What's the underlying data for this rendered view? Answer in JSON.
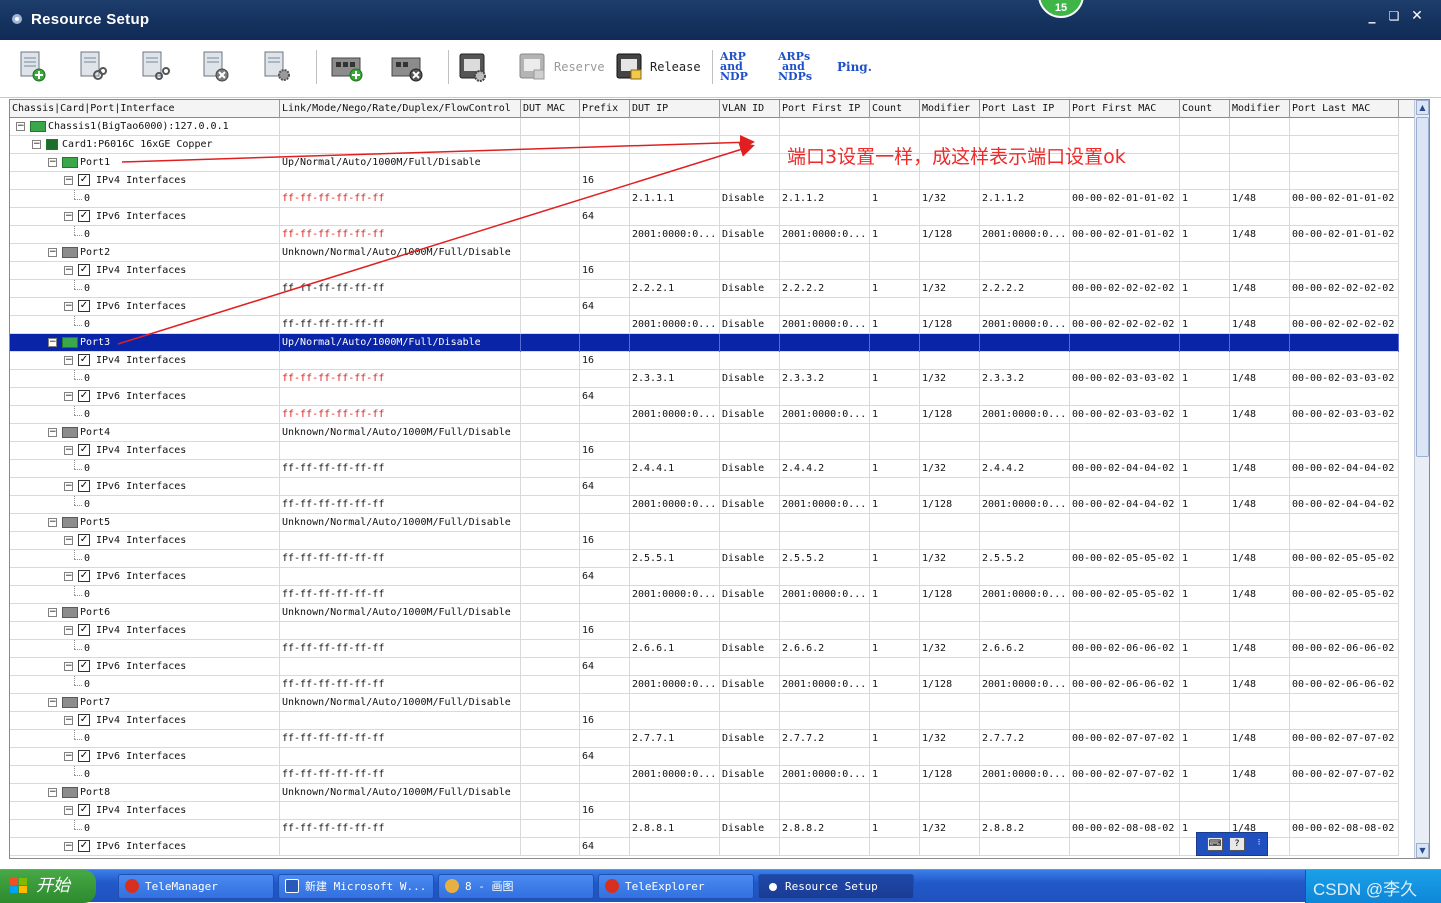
{
  "window": {
    "title": "Resource Setup",
    "badge": "15",
    "controls": [
      "_",
      "❏",
      "✕"
    ]
  },
  "toolbar": {
    "reserve_label": "Reserve",
    "release_label": "Release",
    "arp_ndp": [
      "ARP",
      "and",
      "NDP"
    ],
    "arps_ndps": [
      "ARPs",
      "and",
      "NDPs"
    ],
    "ping_label": "Ping."
  },
  "columns": [
    "Chassis|Card|Port|Interface",
    "Link/Mode/Nego/Rate/Duplex/FlowControl",
    "DUT MAC",
    "Prefix",
    "DUT IP",
    "VLAN ID",
    "Port First IP",
    "Count",
    "Modifier",
    "Port Last IP",
    "Port First MAC",
    "Count",
    "Modifier",
    "Port Last MAC"
  ],
  "tree_rows": [
    {
      "kind": "chassis",
      "label": "Chassis1(BigTao6000):127.0.0.1"
    },
    {
      "kind": "card",
      "label": "Card1:P6016C 16xGE Copper"
    },
    {
      "kind": "port",
      "label": "Port1",
      "status": "Up/Normal/Auto/1000M/Full/Disable",
      "up": true
    },
    {
      "kind": "iface",
      "label": "IPv4 Interfaces",
      "prefix": "16"
    },
    {
      "kind": "addr",
      "label": "0",
      "mac": "ff-ff-ff-ff-ff-ff",
      "mac_red": true,
      "dut_ip": "2.1.1.1",
      "vlan": "Disable",
      "first_ip": "2.1.1.2",
      "count": "1",
      "modifier": "1/32",
      "last_ip": "2.1.1.2",
      "first_mac": "00-00-02-01-01-02",
      "count2": "1",
      "modifier2": "1/48",
      "last_mac": "00-00-02-01-01-02"
    },
    {
      "kind": "iface",
      "label": "IPv6 Interfaces",
      "prefix": "64"
    },
    {
      "kind": "addr",
      "label": "0",
      "mac": "ff-ff-ff-ff-ff-ff",
      "mac_red": true,
      "dut_ip": "2001:0000:0...",
      "vlan": "Disable",
      "first_ip": "2001:0000:0...",
      "count": "1",
      "modifier": "1/128",
      "last_ip": "2001:0000:0...",
      "first_mac": "00-00-02-01-01-02",
      "count2": "1",
      "modifier2": "1/48",
      "last_mac": "00-00-02-01-01-02"
    },
    {
      "kind": "port",
      "label": "Port2",
      "status": "Unknown/Normal/Auto/1000M/Full/Disable",
      "up": false
    },
    {
      "kind": "iface",
      "label": "IPv4 Interfaces",
      "prefix": "16"
    },
    {
      "kind": "addr",
      "label": "0",
      "mac": "ff-ff-ff-ff-ff-ff",
      "mac_red": false,
      "dut_ip": "2.2.2.1",
      "vlan": "Disable",
      "first_ip": "2.2.2.2",
      "count": "1",
      "modifier": "1/32",
      "last_ip": "2.2.2.2",
      "first_mac": "00-00-02-02-02-02",
      "count2": "1",
      "modifier2": "1/48",
      "last_mac": "00-00-02-02-02-02"
    },
    {
      "kind": "iface",
      "label": "IPv6 Interfaces",
      "prefix": "64"
    },
    {
      "kind": "addr",
      "label": "0",
      "mac": "ff-ff-ff-ff-ff-ff",
      "mac_red": false,
      "dut_ip": "2001:0000:0...",
      "vlan": "Disable",
      "first_ip": "2001:0000:0...",
      "count": "1",
      "modifier": "1/128",
      "last_ip": "2001:0000:0...",
      "first_mac": "00-00-02-02-02-02",
      "count2": "1",
      "modifier2": "1/48",
      "last_mac": "00-00-02-02-02-02"
    },
    {
      "kind": "port",
      "label": "Port3",
      "status": "Up/Normal/Auto/1000M/Full/Disable",
      "up": true,
      "selected": true
    },
    {
      "kind": "iface",
      "label": "IPv4 Interfaces",
      "prefix": "16"
    },
    {
      "kind": "addr",
      "label": "0",
      "mac": "ff-ff-ff-ff-ff-ff",
      "mac_red": true,
      "dut_ip": "2.3.3.1",
      "vlan": "Disable",
      "first_ip": "2.3.3.2",
      "count": "1",
      "modifier": "1/32",
      "last_ip": "2.3.3.2",
      "first_mac": "00-00-02-03-03-02",
      "count2": "1",
      "modifier2": "1/48",
      "last_mac": "00-00-02-03-03-02"
    },
    {
      "kind": "iface",
      "label": "IPv6 Interfaces",
      "prefix": "64"
    },
    {
      "kind": "addr",
      "label": "0",
      "mac": "ff-ff-ff-ff-ff-ff",
      "mac_red": true,
      "dut_ip": "2001:0000:0...",
      "vlan": "Disable",
      "first_ip": "2001:0000:0...",
      "count": "1",
      "modifier": "1/128",
      "last_ip": "2001:0000:0...",
      "first_mac": "00-00-02-03-03-02",
      "count2": "1",
      "modifier2": "1/48",
      "last_mac": "00-00-02-03-03-02"
    },
    {
      "kind": "port",
      "label": "Port4",
      "status": "Unknown/Normal/Auto/1000M/Full/Disable",
      "up": false
    },
    {
      "kind": "iface",
      "label": "IPv4 Interfaces",
      "prefix": "16"
    },
    {
      "kind": "addr",
      "label": "0",
      "mac": "ff-ff-ff-ff-ff-ff",
      "mac_red": false,
      "dut_ip": "2.4.4.1",
      "vlan": "Disable",
      "first_ip": "2.4.4.2",
      "count": "1",
      "modifier": "1/32",
      "last_ip": "2.4.4.2",
      "first_mac": "00-00-02-04-04-02",
      "count2": "1",
      "modifier2": "1/48",
      "last_mac": "00-00-02-04-04-02"
    },
    {
      "kind": "iface",
      "label": "IPv6 Interfaces",
      "prefix": "64"
    },
    {
      "kind": "addr",
      "label": "0",
      "mac": "ff-ff-ff-ff-ff-ff",
      "mac_red": false,
      "dut_ip": "2001:0000:0...",
      "vlan": "Disable",
      "first_ip": "2001:0000:0...",
      "count": "1",
      "modifier": "1/128",
      "last_ip": "2001:0000:0...",
      "first_mac": "00-00-02-04-04-02",
      "count2": "1",
      "modifier2": "1/48",
      "last_mac": "00-00-02-04-04-02"
    },
    {
      "kind": "port",
      "label": "Port5",
      "status": "Unknown/Normal/Auto/1000M/Full/Disable",
      "up": false
    },
    {
      "kind": "iface",
      "label": "IPv4 Interfaces",
      "prefix": "16"
    },
    {
      "kind": "addr",
      "label": "0",
      "mac": "ff-ff-ff-ff-ff-ff",
      "mac_red": false,
      "dut_ip": "2.5.5.1",
      "vlan": "Disable",
      "first_ip": "2.5.5.2",
      "count": "1",
      "modifier": "1/32",
      "last_ip": "2.5.5.2",
      "first_mac": "00-00-02-05-05-02",
      "count2": "1",
      "modifier2": "1/48",
      "last_mac": "00-00-02-05-05-02"
    },
    {
      "kind": "iface",
      "label": "IPv6 Interfaces",
      "prefix": "64"
    },
    {
      "kind": "addr",
      "label": "0",
      "mac": "ff-ff-ff-ff-ff-ff",
      "mac_red": false,
      "dut_ip": "2001:0000:0...",
      "vlan": "Disable",
      "first_ip": "2001:0000:0...",
      "count": "1",
      "modifier": "1/128",
      "last_ip": "2001:0000:0...",
      "first_mac": "00-00-02-05-05-02",
      "count2": "1",
      "modifier2": "1/48",
      "last_mac": "00-00-02-05-05-02"
    },
    {
      "kind": "port",
      "label": "Port6",
      "status": "Unknown/Normal/Auto/1000M/Full/Disable",
      "up": false
    },
    {
      "kind": "iface",
      "label": "IPv4 Interfaces",
      "prefix": "16"
    },
    {
      "kind": "addr",
      "label": "0",
      "mac": "ff-ff-ff-ff-ff-ff",
      "mac_red": false,
      "dut_ip": "2.6.6.1",
      "vlan": "Disable",
      "first_ip": "2.6.6.2",
      "count": "1",
      "modifier": "1/32",
      "last_ip": "2.6.6.2",
      "first_mac": "00-00-02-06-06-02",
      "count2": "1",
      "modifier2": "1/48",
      "last_mac": "00-00-02-06-06-02"
    },
    {
      "kind": "iface",
      "label": "IPv6 Interfaces",
      "prefix": "64"
    },
    {
      "kind": "addr",
      "label": "0",
      "mac": "ff-ff-ff-ff-ff-ff",
      "mac_red": false,
      "dut_ip": "2001:0000:0...",
      "vlan": "Disable",
      "first_ip": "2001:0000:0...",
      "count": "1",
      "modifier": "1/128",
      "last_ip": "2001:0000:0...",
      "first_mac": "00-00-02-06-06-02",
      "count2": "1",
      "modifier2": "1/48",
      "last_mac": "00-00-02-06-06-02"
    },
    {
      "kind": "port",
      "label": "Port7",
      "status": "Unknown/Normal/Auto/1000M/Full/Disable",
      "up": false
    },
    {
      "kind": "iface",
      "label": "IPv4 Interfaces",
      "prefix": "16"
    },
    {
      "kind": "addr",
      "label": "0",
      "mac": "ff-ff-ff-ff-ff-ff",
      "mac_red": false,
      "dut_ip": "2.7.7.1",
      "vlan": "Disable",
      "first_ip": "2.7.7.2",
      "count": "1",
      "modifier": "1/32",
      "last_ip": "2.7.7.2",
      "first_mac": "00-00-02-07-07-02",
      "count2": "1",
      "modifier2": "1/48",
      "last_mac": "00-00-02-07-07-02"
    },
    {
      "kind": "iface",
      "label": "IPv6 Interfaces",
      "prefix": "64"
    },
    {
      "kind": "addr",
      "label": "0",
      "mac": "ff-ff-ff-ff-ff-ff",
      "mac_red": false,
      "dut_ip": "2001:0000:0...",
      "vlan": "Disable",
      "first_ip": "2001:0000:0...",
      "count": "1",
      "modifier": "1/128",
      "last_ip": "2001:0000:0...",
      "first_mac": "00-00-02-07-07-02",
      "count2": "1",
      "modifier2": "1/48",
      "last_mac": "00-00-02-07-07-02"
    },
    {
      "kind": "port",
      "label": "Port8",
      "status": "Unknown/Normal/Auto/1000M/Full/Disable",
      "up": false
    },
    {
      "kind": "iface",
      "label": "IPv4 Interfaces",
      "prefix": "16"
    },
    {
      "kind": "addr",
      "label": "0",
      "mac": "ff-ff-ff-ff-ff-ff",
      "mac_red": false,
      "dut_ip": "2.8.8.1",
      "vlan": "Disable",
      "first_ip": "2.8.8.2",
      "count": "1",
      "modifier": "1/32",
      "last_ip": "2.8.8.2",
      "first_mac": "00-00-02-08-08-02",
      "count2": "1",
      "modifier2": "1/48",
      "last_mac": "00-00-02-08-08-02"
    },
    {
      "kind": "iface",
      "label": "IPv6 Interfaces",
      "prefix": "64"
    }
  ],
  "annotation": {
    "text": "端口3设置一样，成这样表示端口设置ok",
    "color": "#ee2a2a"
  },
  "taskbar": {
    "start_label": "开始",
    "tasks": [
      "TeleManager",
      "新建 Microsoft W...",
      "8 - 画图",
      "TeleExplorer",
      "Resource Setup"
    ],
    "watermark": "CSDN @李久"
  },
  "colors": {
    "titlebar": "#0f2a55",
    "selection": "#0a24a8",
    "link_blue": "#1e50c8",
    "badge_green": "#3fb548"
  }
}
